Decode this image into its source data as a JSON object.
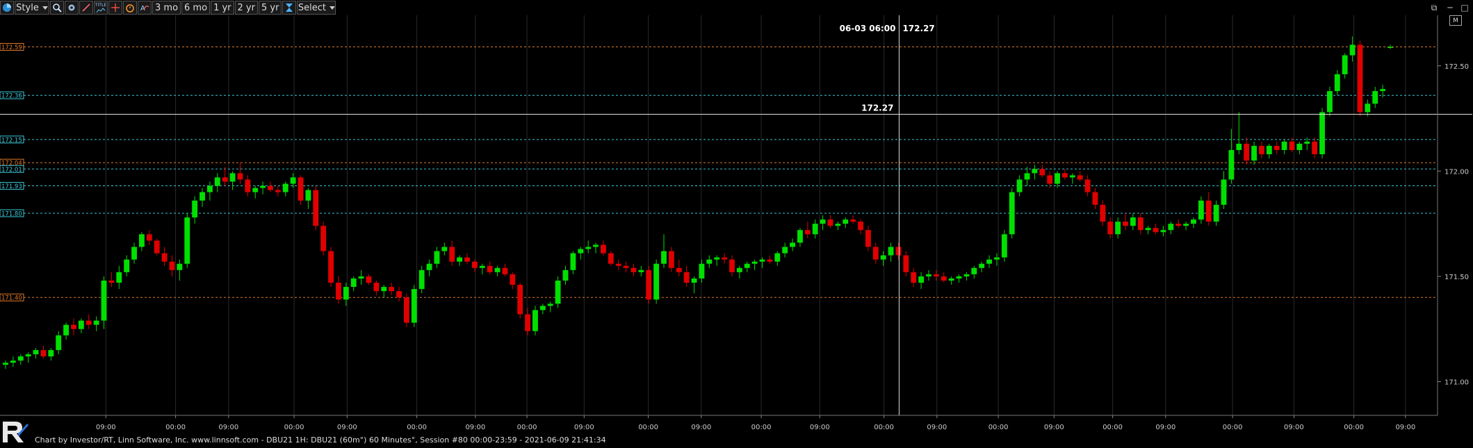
{
  "toolbar": {
    "style_label": "Style",
    "btn_3mo": "3 mo",
    "btn_6mo": "6 mo",
    "btn_1yr": "1 yr",
    "btn_2yr": "2 yr",
    "btn_5yr": "5 yr",
    "select_label": "Select",
    "title_icon_text": "TITLE"
  },
  "badge_m": "M",
  "footer": "Chart by Investor/RT, Linn Software, Inc. www.linnsoft.com - DBU21 1H: DBU21 (60m°) 60 Minutes°, Session #80 00:00-23:59 - 2021-06-09 21:41:34",
  "colors": {
    "up": "#00e000",
    "down": "#e00000",
    "orange_line": "#e07a2a",
    "cyan_line": "#3cc8d8",
    "crosshair": "#e0e0e0",
    "grid": "#2a2a2a"
  },
  "chart_data": {
    "type": "candlestick",
    "ylim": [
      170.84,
      172.74
    ],
    "y_ticks": [
      "172.50",
      "172.00",
      "171.50",
      "171.00"
    ],
    "y_tick_values": [
      172.5,
      172.0,
      171.5,
      171.0
    ],
    "x_tick_labels": [
      "09:00",
      "00:00",
      "09:00",
      "00:00",
      "09:00",
      "00:00",
      "09:00",
      "00:00",
      "09:00",
      "00:00",
      "09:00",
      "00:00",
      "09:00",
      "00:00",
      "09:00",
      "00:00",
      "09:00",
      "00:00",
      "09:00",
      "00:00",
      "09:00",
      "00:00",
      "09:00"
    ],
    "x_tick_positions": [
      0.045,
      0.095,
      0.133,
      0.18,
      0.218,
      0.268,
      0.31,
      0.347,
      0.388,
      0.434,
      0.472,
      0.515,
      0.557,
      0.603,
      0.641,
      0.685,
      0.725,
      0.767,
      0.805,
      0.853,
      0.897,
      0.94,
      0.977
    ],
    "reference_lines": [
      {
        "label": "172.59",
        "value": 172.59,
        "color": "orange"
      },
      {
        "label": "172.36",
        "value": 172.36,
        "color": "cyan"
      },
      {
        "label": "172.15",
        "value": 172.15,
        "color": "cyan"
      },
      {
        "label": "172.04",
        "value": 172.04,
        "color": "orange"
      },
      {
        "label": "172.01",
        "value": 172.01,
        "color": "cyan"
      },
      {
        "label": "171.93",
        "value": 171.93,
        "color": "cyan"
      },
      {
        "label": "171.80",
        "value": 171.8,
        "color": "cyan"
      },
      {
        "label": "171.40",
        "value": 171.4,
        "color": "orange"
      }
    ],
    "crosshair": {
      "price": "172.27",
      "price_value": 172.27,
      "time": "06-03 06:00",
      "x_fraction": 0.574
    },
    "candles": [
      [
        171.08,
        171.1,
        171.06,
        171.09
      ],
      [
        171.09,
        171.12,
        171.07,
        171.1
      ],
      [
        171.1,
        171.13,
        171.08,
        171.12
      ],
      [
        171.12,
        171.14,
        171.09,
        171.13
      ],
      [
        171.13,
        171.16,
        171.11,
        171.15
      ],
      [
        171.15,
        171.17,
        171.11,
        171.12
      ],
      [
        171.12,
        171.16,
        171.1,
        171.15
      ],
      [
        171.15,
        171.24,
        171.13,
        171.22
      ],
      [
        171.22,
        171.28,
        171.2,
        171.27
      ],
      [
        171.27,
        171.3,
        171.22,
        171.25
      ],
      [
        171.25,
        171.3,
        171.23,
        171.29
      ],
      [
        171.29,
        171.32,
        171.25,
        171.27
      ],
      [
        171.27,
        171.31,
        171.24,
        171.29
      ],
      [
        171.29,
        171.5,
        171.25,
        171.48
      ],
      [
        171.48,
        171.52,
        171.45,
        171.47
      ],
      [
        171.47,
        171.55,
        171.44,
        171.52
      ],
      [
        171.52,
        171.6,
        171.5,
        171.58
      ],
      [
        171.58,
        171.66,
        171.56,
        171.64
      ],
      [
        171.64,
        171.71,
        171.62,
        171.7
      ],
      [
        171.7,
        171.72,
        171.65,
        171.67
      ],
      [
        171.67,
        171.68,
        171.6,
        171.61
      ],
      [
        171.61,
        171.64,
        171.55,
        171.57
      ],
      [
        171.57,
        171.6,
        171.5,
        171.53
      ],
      [
        171.53,
        171.58,
        171.48,
        171.56
      ],
      [
        171.56,
        171.8,
        171.54,
        171.78
      ],
      [
        171.78,
        171.88,
        171.75,
        171.86
      ],
      [
        171.86,
        171.92,
        171.83,
        171.9
      ],
      [
        171.9,
        171.95,
        171.86,
        171.93
      ],
      [
        171.93,
        171.99,
        171.9,
        171.97
      ],
      [
        171.97,
        172.02,
        171.93,
        171.95
      ],
      [
        171.95,
        172.0,
        171.91,
        171.99
      ],
      [
        171.99,
        172.04,
        171.94,
        171.96
      ],
      [
        171.96,
        171.98,
        171.88,
        171.9
      ],
      [
        171.9,
        171.93,
        171.87,
        171.92
      ],
      [
        171.92,
        171.95,
        171.89,
        171.93
      ],
      [
        171.93,
        171.95,
        171.9,
        171.91
      ],
      [
        171.91,
        171.93,
        171.88,
        171.9
      ],
      [
        171.9,
        171.95,
        171.88,
        171.94
      ],
      [
        171.94,
        171.99,
        171.92,
        171.97
      ],
      [
        171.97,
        171.98,
        171.84,
        171.86
      ],
      [
        171.86,
        171.92,
        171.82,
        171.91
      ],
      [
        171.91,
        171.93,
        171.72,
        171.74
      ],
      [
        171.74,
        171.76,
        171.6,
        171.62
      ],
      [
        171.62,
        171.64,
        171.45,
        171.47
      ],
      [
        171.47,
        171.5,
        171.37,
        171.39
      ],
      [
        171.39,
        171.47,
        171.36,
        171.45
      ],
      [
        171.45,
        171.5,
        171.43,
        171.49
      ],
      [
        171.49,
        171.53,
        171.46,
        171.5
      ],
      [
        171.5,
        171.51,
        171.46,
        171.47
      ],
      [
        171.47,
        171.48,
        171.41,
        171.43
      ],
      [
        171.43,
        171.46,
        171.4,
        171.45
      ],
      [
        171.45,
        171.47,
        171.41,
        171.43
      ],
      [
        171.43,
        171.45,
        171.38,
        171.4
      ],
      [
        171.4,
        171.42,
        171.26,
        171.28
      ],
      [
        171.28,
        171.46,
        171.26,
        171.44
      ],
      [
        171.44,
        171.55,
        171.42,
        171.53
      ],
      [
        171.53,
        171.58,
        171.5,
        171.56
      ],
      [
        171.56,
        171.64,
        171.54,
        171.62
      ],
      [
        171.62,
        171.66,
        171.6,
        171.64
      ],
      [
        171.64,
        171.67,
        171.55,
        171.57
      ],
      [
        171.57,
        171.6,
        171.55,
        171.59
      ],
      [
        171.59,
        171.61,
        171.56,
        171.57
      ],
      [
        171.57,
        171.58,
        171.52,
        171.54
      ],
      [
        171.54,
        171.56,
        171.51,
        171.55
      ],
      [
        171.55,
        171.57,
        171.51,
        171.52
      ],
      [
        171.52,
        171.55,
        171.5,
        171.54
      ],
      [
        171.54,
        171.56,
        171.5,
        171.51
      ],
      [
        171.51,
        171.52,
        171.44,
        171.46
      ],
      [
        171.46,
        171.47,
        171.3,
        171.32
      ],
      [
        171.32,
        171.35,
        171.22,
        171.24
      ],
      [
        171.24,
        171.36,
        171.22,
        171.34
      ],
      [
        171.34,
        171.37,
        171.32,
        171.36
      ],
      [
        171.36,
        171.38,
        171.33,
        171.37
      ],
      [
        171.37,
        171.5,
        171.35,
        171.48
      ],
      [
        171.48,
        171.55,
        171.46,
        171.53
      ],
      [
        171.53,
        171.62,
        171.51,
        171.61
      ],
      [
        171.61,
        171.64,
        171.58,
        171.63
      ],
      [
        171.63,
        171.67,
        171.61,
        171.64
      ],
      [
        171.64,
        171.66,
        171.61,
        171.65
      ],
      [
        171.65,
        171.67,
        171.6,
        171.61
      ],
      [
        171.61,
        171.62,
        171.55,
        171.56
      ],
      [
        171.56,
        171.58,
        171.53,
        171.55
      ],
      [
        171.55,
        171.57,
        171.52,
        171.54
      ],
      [
        171.54,
        171.56,
        171.5,
        171.52
      ],
      [
        171.52,
        171.55,
        171.5,
        171.53
      ],
      [
        171.53,
        171.55,
        171.37,
        171.39
      ],
      [
        171.39,
        171.58,
        171.37,
        171.56
      ],
      [
        171.56,
        171.7,
        171.54,
        171.62
      ],
      [
        171.62,
        171.64,
        171.52,
        171.54
      ],
      [
        171.54,
        171.58,
        171.5,
        171.52
      ],
      [
        171.52,
        171.55,
        171.45,
        171.47
      ],
      [
        171.47,
        171.5,
        171.42,
        171.49
      ],
      [
        171.49,
        171.58,
        171.47,
        171.56
      ],
      [
        171.56,
        171.6,
        171.54,
        171.58
      ],
      [
        171.58,
        171.6,
        171.55,
        171.59
      ],
      [
        171.59,
        171.61,
        171.56,
        171.58
      ],
      [
        171.58,
        171.6,
        171.5,
        171.52
      ],
      [
        171.52,
        171.55,
        171.49,
        171.54
      ],
      [
        171.54,
        171.57,
        171.52,
        171.56
      ],
      [
        171.56,
        171.58,
        171.53,
        171.57
      ],
      [
        171.57,
        171.59,
        171.54,
        171.58
      ],
      [
        171.58,
        171.6,
        171.56,
        171.57
      ],
      [
        171.57,
        171.62,
        171.55,
        171.61
      ],
      [
        171.61,
        171.66,
        171.59,
        171.64
      ],
      [
        171.64,
        171.68,
        171.62,
        171.66
      ],
      [
        171.66,
        171.73,
        171.64,
        171.72
      ],
      [
        171.72,
        171.76,
        171.68,
        171.7
      ],
      [
        171.7,
        171.77,
        171.68,
        171.75
      ],
      [
        171.75,
        171.79,
        171.72,
        171.77
      ],
      [
        171.77,
        171.79,
        171.73,
        171.74
      ],
      [
        171.74,
        171.76,
        171.72,
        171.75
      ],
      [
        171.75,
        171.78,
        171.73,
        171.77
      ],
      [
        171.77,
        171.79,
        171.75,
        171.76
      ],
      [
        171.76,
        171.77,
        171.7,
        171.72
      ],
      [
        171.72,
        171.74,
        171.62,
        171.64
      ],
      [
        171.64,
        171.66,
        171.56,
        171.58
      ],
      [
        171.58,
        171.62,
        171.55,
        171.6
      ],
      [
        171.6,
        171.66,
        171.57,
        171.64
      ],
      [
        171.64,
        171.66,
        171.58,
        171.6
      ],
      [
        171.6,
        171.62,
        171.5,
        171.52
      ],
      [
        171.52,
        171.54,
        171.45,
        171.47
      ],
      [
        171.47,
        171.52,
        171.44,
        171.5
      ],
      [
        171.5,
        171.53,
        171.48,
        171.51
      ],
      [
        171.51,
        171.53,
        171.48,
        171.5
      ],
      [
        171.5,
        171.52,
        171.47,
        171.48
      ],
      [
        171.48,
        171.5,
        171.46,
        171.49
      ],
      [
        171.49,
        171.51,
        171.47,
        171.5
      ],
      [
        171.5,
        171.52,
        171.48,
        171.51
      ],
      [
        171.51,
        171.55,
        171.49,
        171.54
      ],
      [
        171.54,
        171.57,
        171.52,
        171.56
      ],
      [
        171.56,
        171.6,
        171.54,
        171.58
      ],
      [
        171.58,
        171.61,
        171.55,
        171.59
      ],
      [
        171.59,
        171.72,
        171.57,
        171.7
      ],
      [
        171.7,
        171.92,
        171.68,
        171.9
      ],
      [
        171.9,
        171.98,
        171.88,
        171.96
      ],
      [
        171.96,
        172.02,
        171.93,
        171.99
      ],
      [
        171.99,
        172.03,
        171.96,
        172.01
      ],
      [
        172.01,
        172.03,
        171.97,
        171.98
      ],
      [
        171.98,
        172.0,
        171.92,
        171.94
      ],
      [
        171.94,
        172.0,
        171.92,
        171.99
      ],
      [
        171.99,
        172.01,
        171.96,
        171.97
      ],
      [
        171.97,
        171.99,
        171.94,
        171.98
      ],
      [
        171.98,
        172.0,
        171.95,
        171.96
      ],
      [
        171.96,
        171.98,
        171.88,
        171.9
      ],
      [
        171.9,
        171.92,
        171.82,
        171.84
      ],
      [
        171.84,
        171.86,
        171.74,
        171.76
      ],
      [
        171.76,
        171.78,
        171.68,
        171.7
      ],
      [
        171.7,
        171.78,
        171.68,
        171.76
      ],
      [
        171.76,
        171.8,
        171.72,
        171.74
      ],
      [
        171.74,
        171.8,
        171.72,
        171.78
      ],
      [
        171.78,
        171.8,
        171.7,
        171.72
      ],
      [
        171.72,
        171.74,
        171.7,
        171.73
      ],
      [
        171.73,
        171.75,
        171.7,
        171.71
      ],
      [
        171.71,
        171.74,
        171.69,
        171.72
      ],
      [
        171.72,
        171.76,
        171.7,
        171.75
      ],
      [
        171.75,
        171.77,
        171.73,
        171.74
      ],
      [
        171.74,
        171.76,
        171.72,
        171.75
      ],
      [
        171.75,
        171.78,
        171.73,
        171.77
      ],
      [
        171.77,
        171.88,
        171.75,
        171.86
      ],
      [
        171.86,
        171.9,
        171.74,
        171.76
      ],
      [
        171.76,
        171.86,
        171.74,
        171.84
      ],
      [
        171.84,
        172.0,
        171.82,
        171.96
      ],
      [
        171.96,
        172.2,
        171.94,
        172.1
      ],
      [
        172.1,
        172.28,
        172.08,
        172.13
      ],
      [
        172.13,
        172.16,
        172.03,
        172.05
      ],
      [
        172.05,
        172.14,
        172.03,
        172.12
      ],
      [
        172.12,
        172.14,
        172.06,
        172.08
      ],
      [
        172.08,
        172.13,
        172.06,
        172.12
      ],
      [
        172.12,
        172.14,
        172.08,
        172.1
      ],
      [
        172.1,
        172.15,
        172.08,
        172.14
      ],
      [
        172.14,
        172.16,
        172.09,
        172.1
      ],
      [
        172.1,
        172.14,
        172.08,
        172.13
      ],
      [
        172.13,
        172.16,
        172.1,
        172.14
      ],
      [
        172.14,
        172.16,
        172.06,
        172.08
      ],
      [
        172.08,
        172.3,
        172.06,
        172.28
      ],
      [
        172.28,
        172.4,
        172.26,
        172.38
      ],
      [
        172.38,
        172.48,
        172.36,
        172.46
      ],
      [
        172.46,
        172.56,
        172.44,
        172.55
      ],
      [
        172.55,
        172.64,
        172.52,
        172.6
      ],
      [
        172.6,
        172.62,
        172.26,
        172.28
      ],
      [
        172.28,
        172.34,
        172.26,
        172.32
      ],
      [
        172.32,
        172.4,
        172.3,
        172.38
      ],
      [
        172.38,
        172.41,
        172.35,
        172.39
      ],
      [
        172.59,
        172.6,
        172.58,
        172.59
      ]
    ]
  }
}
